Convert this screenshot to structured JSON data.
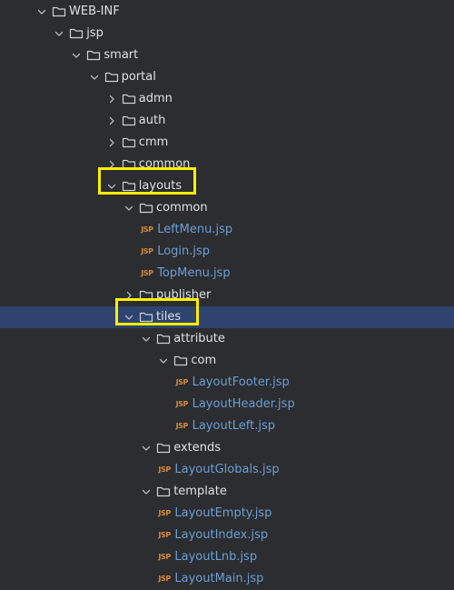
{
  "file_tree": {
    "rows": [
      {
        "label": "WEB-INF",
        "kind": "folder",
        "depth": 0,
        "expanded": true
      },
      {
        "label": "jsp",
        "kind": "folder",
        "depth": 1,
        "expanded": true
      },
      {
        "label": "smart",
        "kind": "folder",
        "depth": 2,
        "expanded": true
      },
      {
        "label": "portal",
        "kind": "folder",
        "depth": 3,
        "expanded": true
      },
      {
        "label": "admn",
        "kind": "folder",
        "depth": 4,
        "expanded": false
      },
      {
        "label": "auth",
        "kind": "folder",
        "depth": 4,
        "expanded": false
      },
      {
        "label": "cmm",
        "kind": "folder",
        "depth": 4,
        "expanded": false
      },
      {
        "label": "common",
        "kind": "folder",
        "depth": 4,
        "expanded": false
      },
      {
        "label": "layouts",
        "kind": "folder",
        "depth": 4,
        "expanded": true,
        "highlighted": true
      },
      {
        "label": "common",
        "kind": "folder",
        "depth": 5,
        "expanded": true
      },
      {
        "label": "LeftMenu.jsp",
        "kind": "file",
        "depth": 6
      },
      {
        "label": "Login.jsp",
        "kind": "file",
        "depth": 6
      },
      {
        "label": "TopMenu.jsp",
        "kind": "file",
        "depth": 6
      },
      {
        "label": "publisher",
        "kind": "folder",
        "depth": 5,
        "expanded": false
      },
      {
        "label": "tiles",
        "kind": "folder",
        "depth": 5,
        "expanded": true,
        "selected": true,
        "highlighted": true
      },
      {
        "label": "attribute",
        "kind": "folder",
        "depth": 6,
        "expanded": true
      },
      {
        "label": "com",
        "kind": "folder",
        "depth": 7,
        "expanded": true
      },
      {
        "label": "LayoutFooter.jsp",
        "kind": "file",
        "depth": 8
      },
      {
        "label": "LayoutHeader.jsp",
        "kind": "file",
        "depth": 8
      },
      {
        "label": "LayoutLeft.jsp",
        "kind": "file",
        "depth": 8
      },
      {
        "label": "extends",
        "kind": "folder",
        "depth": 6,
        "expanded": true
      },
      {
        "label": "LayoutGlobals.jsp",
        "kind": "file",
        "depth": 7
      },
      {
        "label": "template",
        "kind": "folder",
        "depth": 6,
        "expanded": true
      },
      {
        "label": "LayoutEmpty.jsp",
        "kind": "file",
        "depth": 7
      },
      {
        "label": "LayoutIndex.jsp",
        "kind": "file",
        "depth": 7
      },
      {
        "label": "LayoutLnb.jsp",
        "kind": "file",
        "depth": 7
      },
      {
        "label": "LayoutMain.jsp",
        "kind": "file",
        "depth": 7
      }
    ],
    "file_badge": "JSP",
    "colors": {
      "background": "#2b2d30",
      "selection": "#2e436e",
      "folder_text": "#dfe1e5",
      "file_text": "#6e9ed5",
      "jsp_badge": "#d58a3b",
      "annotation_box": "#ffee00"
    },
    "icons": {
      "expanded_chevron": "chevron-down-icon",
      "collapsed_chevron": "chevron-right-icon",
      "folder": "folder-icon",
      "file": "jsp-file-icon"
    }
  }
}
